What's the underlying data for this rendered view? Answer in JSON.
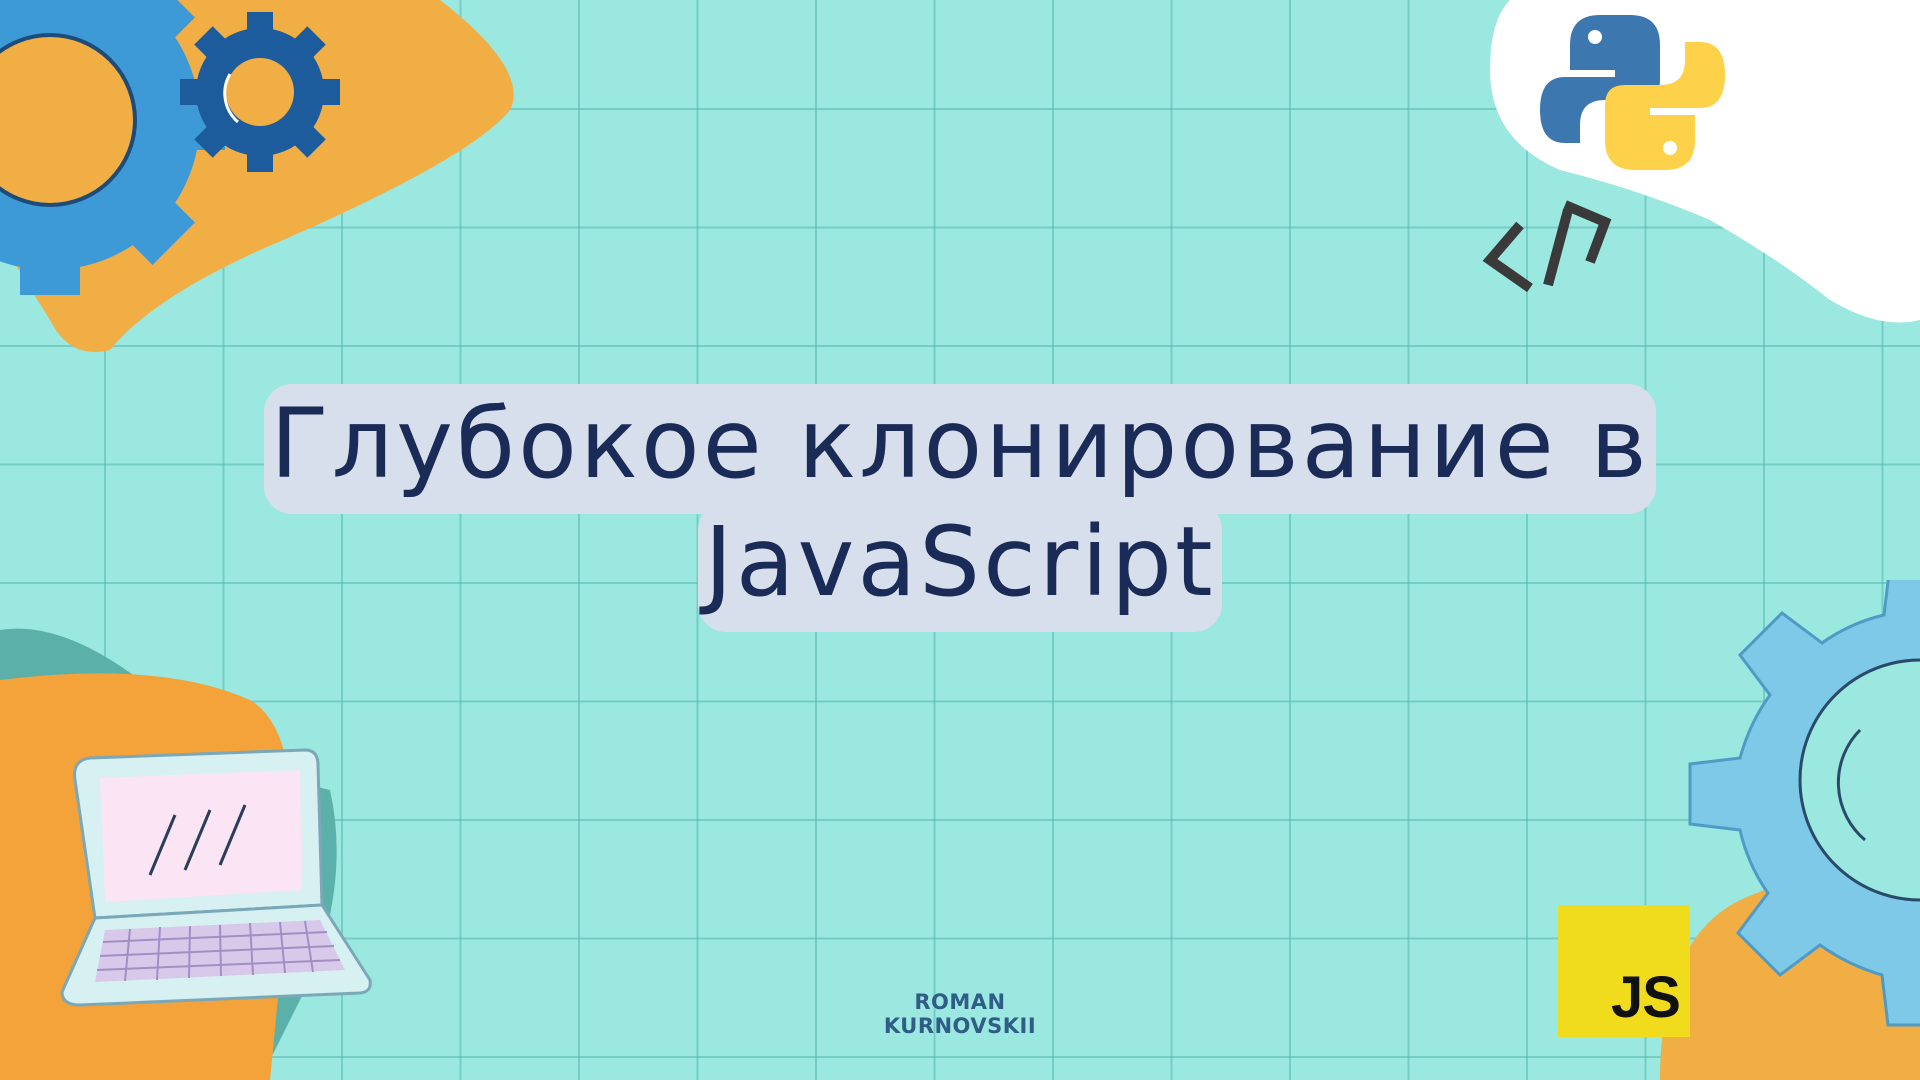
{
  "slide": {
    "title": "Глубокое клонирование в JavaScript",
    "author": "ROMAN KURNOVSKII"
  },
  "badges": {
    "js_label": "JS",
    "code_symbol": "</>"
  },
  "colors": {
    "background": "#9ae8df",
    "grid": "#46afa8",
    "title_text": "#1b2b57",
    "title_highlight": "#d6dfeb",
    "author_text": "#2f5d86",
    "orange": "#f2a83c",
    "gear_dark_blue": "#1d5c9c",
    "gear_light_blue": "#7ec9e8",
    "js_yellow": "#f0db1c",
    "python_blue": "#3c77b0",
    "python_yellow": "#fdd24a"
  },
  "icons": [
    "gear-icon",
    "python-logo-icon",
    "code-brackets-icon",
    "laptop-icon",
    "js-logo-icon"
  ]
}
